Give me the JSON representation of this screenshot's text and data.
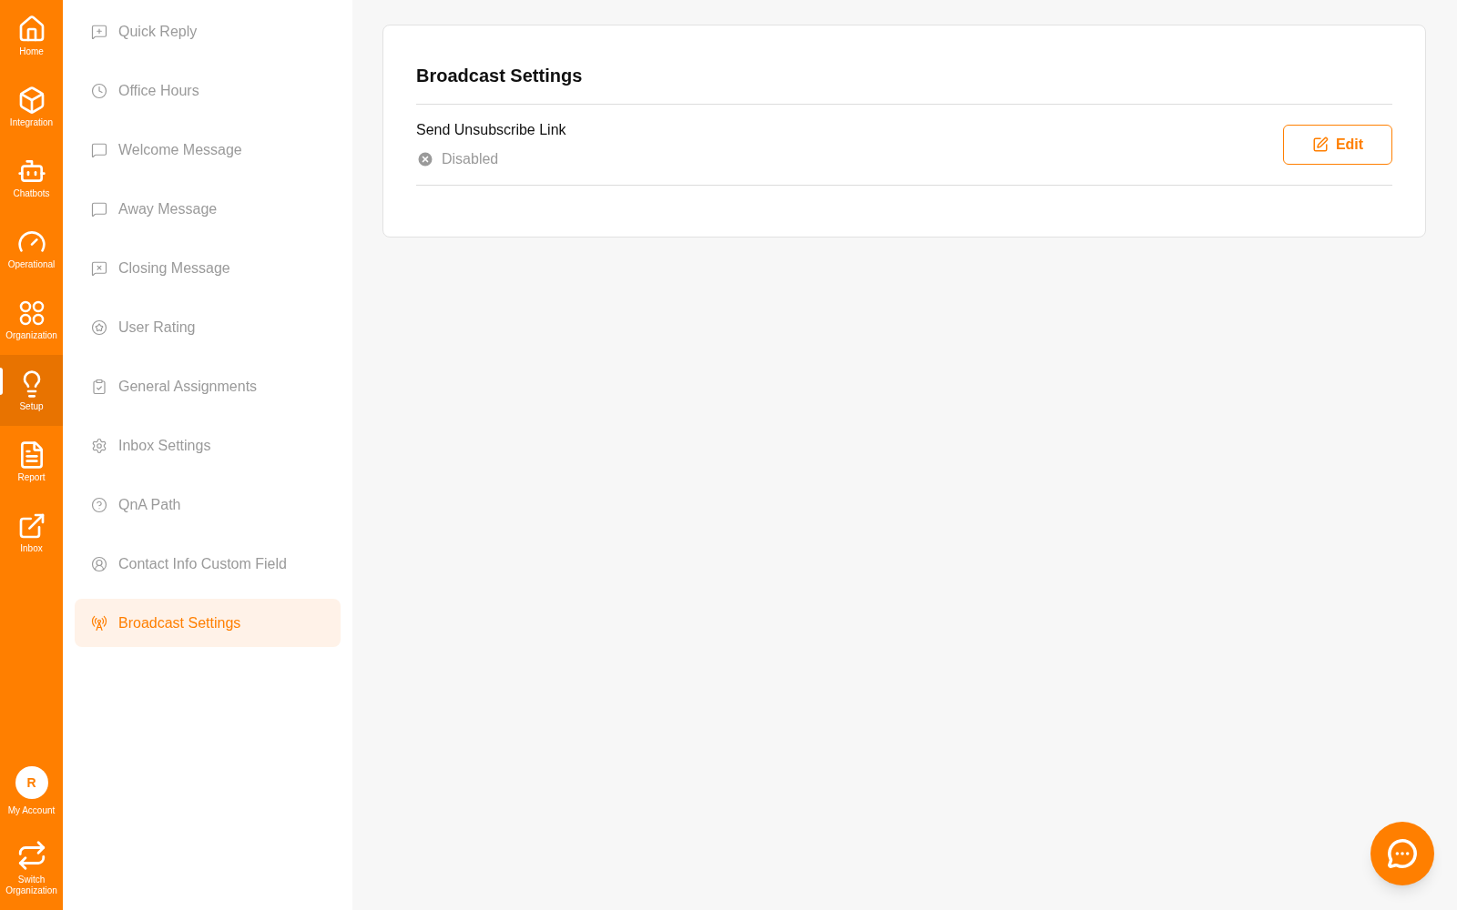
{
  "rail": {
    "items": [
      {
        "label": "Home",
        "selected": false
      },
      {
        "label": "Integration",
        "selected": false
      },
      {
        "label": "Chatbots",
        "selected": false
      },
      {
        "label": "Operational",
        "selected": false
      },
      {
        "label": "Organization",
        "selected": false
      },
      {
        "label": "Setup",
        "selected": true
      },
      {
        "label": "Report",
        "selected": false
      },
      {
        "label": "Inbox",
        "selected": false
      }
    ],
    "account": {
      "initial": "R",
      "label": "My Account"
    },
    "switch": {
      "label": "Switch Organization"
    }
  },
  "submenu": {
    "items": [
      {
        "label": "Quick Reply",
        "selected": false
      },
      {
        "label": "Office Hours",
        "selected": false
      },
      {
        "label": "Welcome Message",
        "selected": false
      },
      {
        "label": "Away Message",
        "selected": false
      },
      {
        "label": "Closing Message",
        "selected": false
      },
      {
        "label": "User Rating",
        "selected": false
      },
      {
        "label": "General Assignments",
        "selected": false
      },
      {
        "label": "Inbox Settings",
        "selected": false
      },
      {
        "label": "QnA Path",
        "selected": false
      },
      {
        "label": "Contact Info Custom Field",
        "selected": false
      },
      {
        "label": "Broadcast Settings",
        "selected": true
      }
    ]
  },
  "card": {
    "title": "Broadcast Settings",
    "settings": [
      {
        "name": "Send Unsubscribe Link",
        "status": "Disabled",
        "enabled": false,
        "button": "Edit"
      }
    ]
  }
}
